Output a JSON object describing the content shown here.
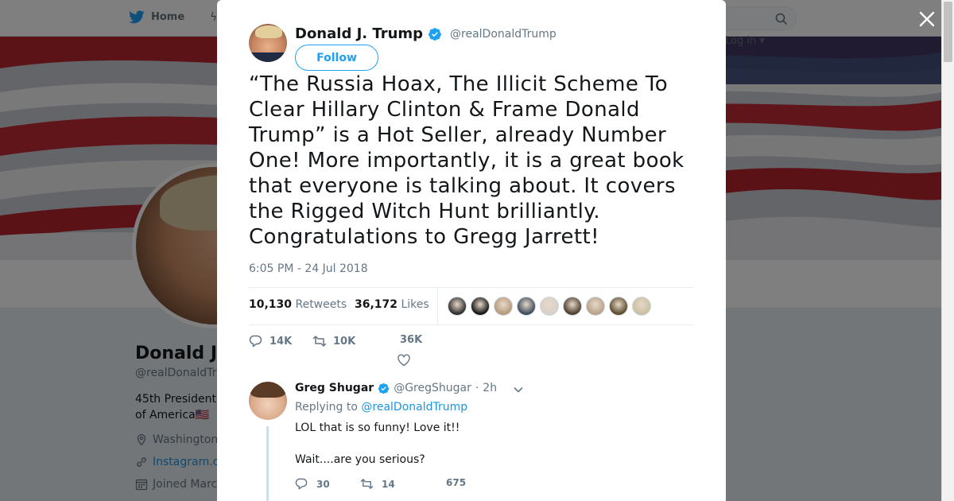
{
  "topbar": {
    "home_label": "Home",
    "login_stub": "Log in ▾"
  },
  "profile": {
    "name": "Donald J.",
    "handle": "@realDonaldTr",
    "bio": "45th President of America",
    "flag": "🇺🇸",
    "location": "Washington",
    "link": "Instagram.c",
    "joined": "Joined Marc"
  },
  "tweet": {
    "author_name": "Donald J. Trump",
    "author_handle": "@realDonaldTrump",
    "follow_label": "Follow",
    "text": "“The Russia Hoax, The Illicit Scheme To Clear Hillary Clinton & Frame Donald Trump” is a Hot Seller, already Number One! More importantly, it is a great book that everyone is talking about. It covers the Rigged Witch Hunt brilliantly. Congratulations to Gregg Jarrett!",
    "time": "6:05 PM - 24 Jul 2018",
    "retweets_count": "10,130",
    "retweets_label": "Retweets",
    "likes_count": "36,172",
    "likes_label": "Likes",
    "replies_short": "14K",
    "retweets_short": "10K",
    "likes_short": "36K",
    "liker_colors": [
      "#2b2b2b",
      "#111111",
      "#b59a7a",
      "#3a4a5a",
      "#d8d0c8",
      "#4a3b2a",
      "#b8a08a",
      "#5a4a2a",
      "#c8c0a0"
    ]
  },
  "reply": {
    "name": "Greg Shugar",
    "handle": "@GregShugar",
    "dot": "·",
    "time": "2h",
    "replying_prefix": "Replying to",
    "replying_to": "@realDonaldTrump",
    "text": "LOL that is so funny! Love it!!\n\nWait....are you serious?",
    "replies": "30",
    "retweets": "14",
    "likes": "675"
  },
  "colors": {
    "accent": "#1da1f2",
    "link": "#1b95e0",
    "verified": "#1da1f2",
    "overlay": "rgba(0,0,0,0.5)"
  }
}
